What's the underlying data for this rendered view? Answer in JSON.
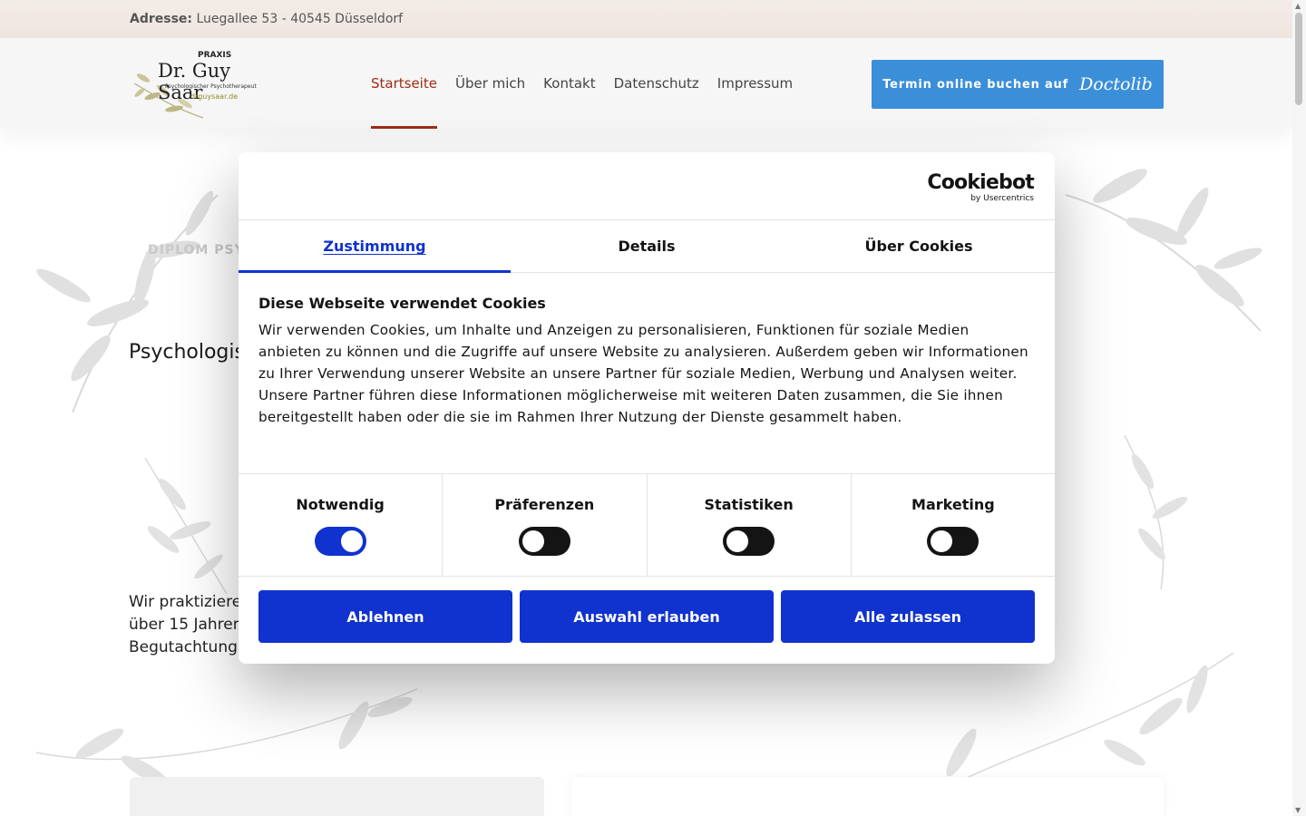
{
  "topbar": {
    "address_label": "Adresse:",
    "address_value": "Luegallee 53 - 40545 Düsseldorf"
  },
  "logo": {
    "praxis": "PRAXIS",
    "name": "Dr. Guy Saar",
    "subtitle": "Psychologischer Psychotherapeut",
    "url": "drguysaar.de"
  },
  "nav": {
    "items": [
      {
        "label": "Startseite",
        "active": true
      },
      {
        "label": "Über mich"
      },
      {
        "label": "Kontakt"
      },
      {
        "label": "Datenschutz"
      },
      {
        "label": "Impressum"
      }
    ]
  },
  "booking": {
    "label": "Termin online buchen auf",
    "brand": "Doctolib"
  },
  "background": {
    "eyebrow": "DIPLOM PSYC",
    "heading": "Psychologis",
    "paragraph_lines": [
      "Wir praktiziere",
      "über 15 Jahren",
      "Begutachtung"
    ]
  },
  "cookie": {
    "brand": "Cookiebot",
    "by": "by Usercentrics",
    "tabs": [
      "Zustimmung",
      "Details",
      "Über Cookies"
    ],
    "title": "Diese Webseite verwendet Cookies",
    "text": "Wir verwenden Cookies, um Inhalte und Anzeigen zu personalisieren, Funktionen für soziale Medien anbieten zu können und die Zugriffe auf unsere Website zu analysieren. Außerdem geben wir Informationen zu Ihrer Verwendung unserer Website an unsere Partner für soziale Medien, Werbung und Analysen weiter. Unsere Partner führen diese Informationen möglicherweise mit weiteren Daten zusammen, die Sie ihnen bereitgestellt haben oder die sie im Rahmen Ihrer Nutzung der Dienste gesammelt haben.",
    "toggles": [
      {
        "label": "Notwendig",
        "on": true
      },
      {
        "label": "Präferenzen",
        "on": false
      },
      {
        "label": "Statistiken",
        "on": false
      },
      {
        "label": "Marketing",
        "on": false
      }
    ],
    "buttons": {
      "reject": "Ablehnen",
      "selection": "Auswahl erlauben",
      "accept_all": "Alle zulassen"
    }
  },
  "colors": {
    "accent": "#1032cf",
    "nav_active": "#9b2e14",
    "booking": "#3b8fd9"
  }
}
